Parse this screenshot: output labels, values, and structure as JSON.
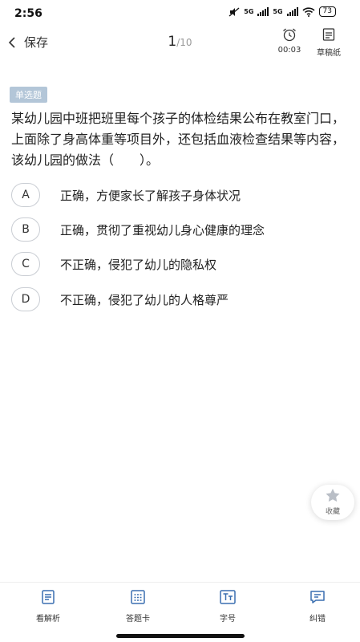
{
  "status": {
    "time": "2:56",
    "network1": "5G",
    "network2": "5G",
    "battery": "73"
  },
  "header": {
    "back_label": "保存",
    "page_current": "1",
    "page_total": "/10",
    "timer": "00:03",
    "draft_label": "草稿纸"
  },
  "question": {
    "type": "单选题",
    "text": "某幼儿园中班把班里每个孩子的体检结果公布在教室门口，上面除了身高体重等项目外，还包括血液检查结果等内容，该幼儿园的做法（　　）。",
    "options": [
      {
        "letter": "A",
        "text": "正确，方便家长了解孩子身体状况"
      },
      {
        "letter": "B",
        "text": "正确，贯彻了重视幼儿身心健康的理念"
      },
      {
        "letter": "C",
        "text": "不正确，侵犯了幼儿的隐私权"
      },
      {
        "letter": "D",
        "text": "不正确，侵犯了幼儿的人格尊严"
      }
    ]
  },
  "favorite": {
    "label": "收藏"
  },
  "bottom_bar": {
    "tabs": [
      {
        "label": "看解析",
        "icon": "analysis-icon"
      },
      {
        "label": "答题卡",
        "icon": "answer-card-icon"
      },
      {
        "label": "字号",
        "icon": "font-size-icon"
      },
      {
        "label": "纠错",
        "icon": "report-error-icon"
      }
    ]
  },
  "colors": {
    "accent": "#3a6fb0",
    "tag_bg": "#b3c6d8"
  }
}
